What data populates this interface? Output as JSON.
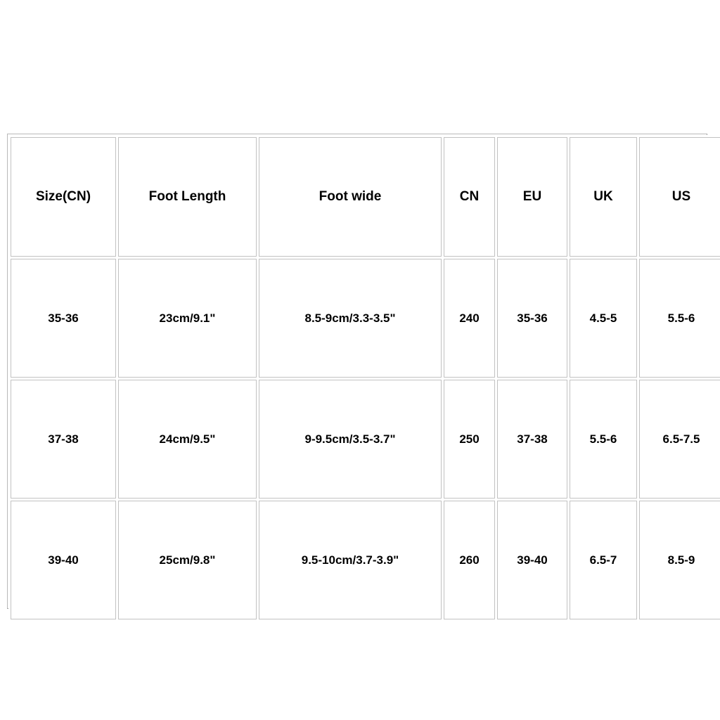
{
  "table": {
    "name": "shoe-size-conversion-chart",
    "columns": [
      {
        "key": "size_cn",
        "label": "Size(CN)"
      },
      {
        "key": "foot_length",
        "label": "Foot Length"
      },
      {
        "key": "foot_wide",
        "label": "Foot wide"
      },
      {
        "key": "cn",
        "label": "CN"
      },
      {
        "key": "eu",
        "label": "EU"
      },
      {
        "key": "uk",
        "label": "UK"
      },
      {
        "key": "us",
        "label": "US"
      }
    ],
    "rows": [
      {
        "size_cn": "35-36",
        "foot_length": "23cm/9.1\"",
        "foot_wide": "8.5-9cm/3.3-3.5\"",
        "cn": "240",
        "eu": "35-36",
        "uk": "4.5-5",
        "us": "5.5-6"
      },
      {
        "size_cn": "37-38",
        "foot_length": "24cm/9.5\"",
        "foot_wide": "9-9.5cm/3.5-3.7\"",
        "cn": "250",
        "eu": "37-38",
        "uk": "5.5-6",
        "us": "6.5-7.5"
      },
      {
        "size_cn": "39-40",
        "foot_length": "25cm/9.8\"",
        "foot_wide": "9.5-10cm/3.7-3.9\"",
        "cn": "260",
        "eu": "39-40",
        "uk": "6.5-7",
        "us": "8.5-9"
      }
    ]
  },
  "colors": {
    "background": "#ffffff",
    "text": "#000000",
    "cell_border": "#c2c2c2",
    "outer_border": "#b9b9b9",
    "outer_border_shadow": "#9a9a9a"
  }
}
